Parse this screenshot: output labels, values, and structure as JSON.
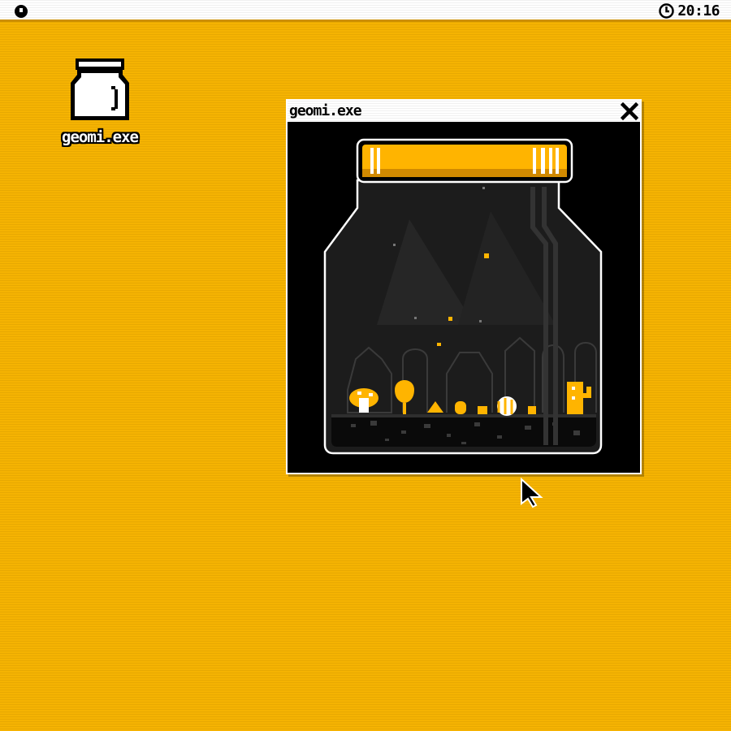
{
  "menubar": {
    "logo_icon": "geomi-logo-icon",
    "clock_icon": "clock-icon",
    "clock_time": "20:16"
  },
  "desktop": {
    "icons": [
      {
        "label": "geomi.exe",
        "icon": "jar-icon"
      }
    ]
  },
  "window": {
    "title": "geomi.exe",
    "close_icon": "close-x-icon",
    "content": "terrarium-jar-scene"
  },
  "cursor": {
    "icon": "arrow-pointer-icon"
  },
  "colors": {
    "desktop": "#f5b302",
    "accent": "#ffb400",
    "bar": "#ffffff",
    "window_bg": "#000000"
  }
}
